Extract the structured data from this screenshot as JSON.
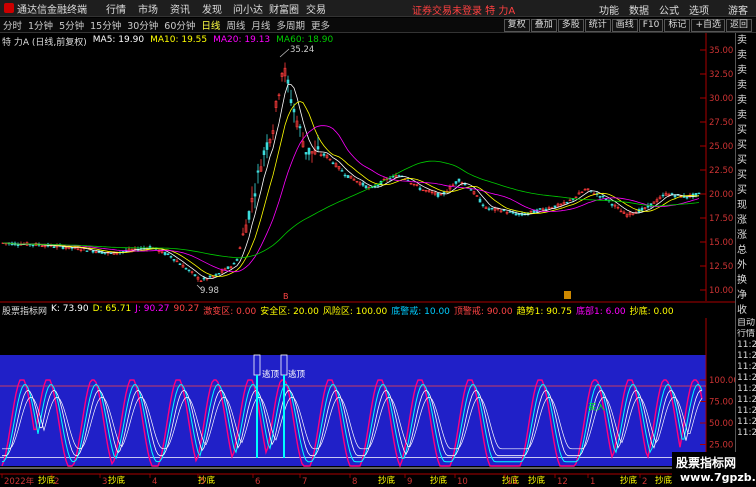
{
  "menubar": {
    "app_name": "通达信金融终端",
    "items": [
      "行情",
      "市场",
      "资讯",
      "发现",
      "问小达",
      "财富圈",
      "交易"
    ],
    "notice": "证券交易未登录  特 力A",
    "right_items": [
      "功能",
      "数据",
      "公式",
      "选项"
    ],
    "right_last": "游客"
  },
  "tabs": {
    "periods": [
      "分时",
      "1分钟",
      "5分钟",
      "15分钟",
      "30分钟",
      "60分钟",
      "日线",
      "周线",
      "月线",
      "多周期",
      "更多"
    ],
    "active": "日线",
    "right_buttons": [
      "复权",
      "叠加",
      "多股",
      "统计",
      "画线",
      "F10",
      "标记",
      "+自选",
      "返回"
    ]
  },
  "main": {
    "legend": {
      "title": "特 力A (日线,前复权)",
      "ma5": "MA5: 19.90",
      "ma10": "MA10: 19.55",
      "ma20": "MA20: 19.13",
      "ma60": "MA60: 18.90"
    },
    "price_axis": [
      "35.00",
      "32.50",
      "30.00",
      "27.50",
      "25.00",
      "22.50",
      "20.00",
      "17.50",
      "15.00",
      "12.50",
      "10.00"
    ],
    "high_label": "35.24",
    "low_label": "9.98",
    "colors": {
      "up": "#ff3c3c",
      "down": "#3cdcdc",
      "ma5": "#ffffff",
      "ma10": "#ffff00",
      "ma20": "#ff00ff",
      "ma60": "#00cc00"
    }
  },
  "indicator": {
    "legend": {
      "name": "股票指标网",
      "k": "K: 73.90",
      "d": "D: 65.71",
      "j": "J: 90.27",
      "v1": "90.27",
      "danger": "激变区: 0.00",
      "safe": "安全区: 20.00",
      "risk": "风险区: 100.00",
      "bottom_warn": "底警戒: 10.00",
      "top_warn": "顶警戒: 90.00",
      "trend": "趋势1: 90.75",
      "bottom_part": "底部1: 6.00",
      "copy_bottom": "抄底: 0.00"
    },
    "axis": [
      "100.00",
      "75.00",
      "50.00",
      "25.00"
    ],
    "bottom_labels": [
      "抄底",
      "抄底",
      "抄底",
      "抄底",
      "抄底",
      "抄底",
      "抄底",
      "抄底",
      "抄底"
    ],
    "tags": [
      "逃顶",
      "逃顶",
      "买入"
    ]
  },
  "date_axis": [
    "2022年",
    "2",
    "3",
    "4",
    "5",
    "6",
    "7",
    "8",
    "9",
    "10",
    "11",
    "12",
    "1",
    "2"
  ],
  "right_panel": [
    "卖比",
    "卖五",
    "卖四",
    "卖三",
    "卖二",
    "卖一",
    "买一",
    "买二",
    "买三",
    "买四",
    "买五",
    "现价",
    "涨跌",
    "涨幅",
    "总量",
    "外盘",
    "换手",
    "净资",
    "收益",
    "自动",
    "行情",
    "11:26",
    "11:26",
    "11:26",
    "11:26",
    "11:26",
    "11:26",
    "11:26",
    "11:26",
    "11:26"
  ],
  "watermark": {
    "line1": "股票指标网",
    "line2": "www.7gpzb.com"
  }
}
